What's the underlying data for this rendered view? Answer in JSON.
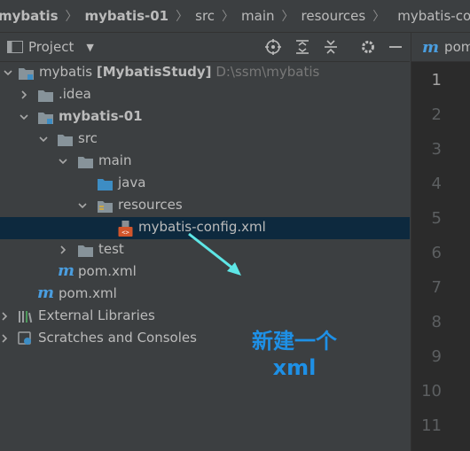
{
  "breadcrumb": {
    "items": [
      "mybatis",
      "mybatis-01",
      "src",
      "main",
      "resources",
      "mybatis-config.xml"
    ]
  },
  "toolbar": {
    "project_label": "Project",
    "icons": [
      "locate-icon",
      "expand-all-icon",
      "collapse-all-icon",
      "gear-icon",
      "minimize-icon"
    ]
  },
  "tree": {
    "root": {
      "name": "mybatis",
      "module": "[MybatisStudy]",
      "path": "D:\\ssm\\mybatis"
    },
    "idea": ".idea",
    "module": "mybatis-01",
    "src": "src",
    "main": "main",
    "java": "java",
    "resources": "resources",
    "config": "mybatis-config.xml",
    "test": "test",
    "module_pom": "pom.xml",
    "root_pom": "pom.xml",
    "external": "External Libraries",
    "scratches": "Scratches and Consoles"
  },
  "editor": {
    "tab_label": "pom",
    "line_numbers": [
      "1",
      "2",
      "3",
      "4",
      "5",
      "6",
      "7",
      "8",
      "9",
      "10",
      "11"
    ]
  },
  "annotation": {
    "line1": "新建一个",
    "line2": "xml",
    "color": "#1e90e6",
    "arrow_color": "#5ee6e6"
  },
  "colors": {
    "panel": "#3c3f41",
    "editor": "#2b2b2b",
    "selection": "#0d293e",
    "folder": "#87939a",
    "source_folder": "#3d8dc4",
    "maven_m": "#4a9ee0",
    "xml_icon": "#d1552b"
  }
}
